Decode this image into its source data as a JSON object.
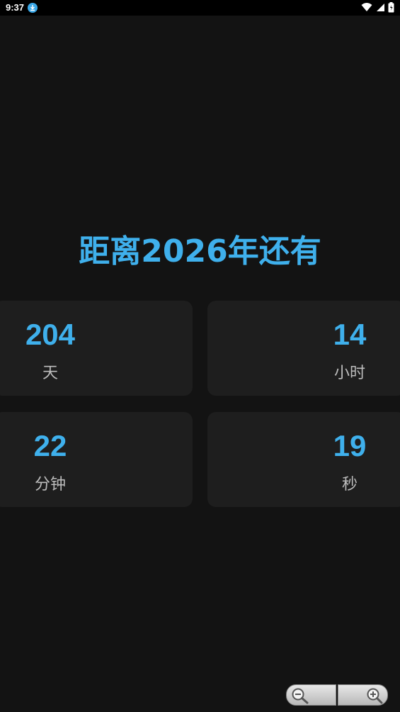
{
  "status_bar": {
    "time": "9:37",
    "icons": [
      "download-icon",
      "wifi-icon",
      "signal-icon",
      "battery-icon"
    ]
  },
  "title": "距离2026年还有",
  "countdown": [
    {
      "value": "204",
      "unit": "天"
    },
    {
      "value": "14",
      "unit": "小时"
    },
    {
      "value": "22",
      "unit": "分钟"
    },
    {
      "value": "19",
      "unit": "秒"
    }
  ],
  "zoom": {
    "out_icon": "zoom-out-icon",
    "in_icon": "zoom-in-icon"
  },
  "colors": {
    "accent": "#3fb0ec",
    "background": "#131313",
    "card": "#1e1e1e",
    "label": "#bdbdbd"
  }
}
